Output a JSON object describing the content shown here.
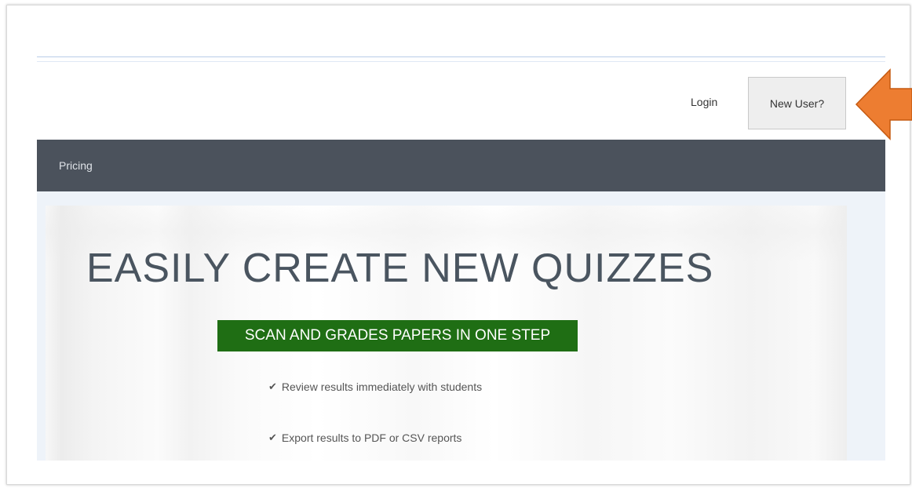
{
  "header": {
    "login_label": "Login",
    "new_user_label": "New User?"
  },
  "navbar": {
    "items": [
      {
        "label": "Pricing"
      }
    ]
  },
  "hero": {
    "title": "EASILY CREATE NEW QUIZZES",
    "badge": "SCAN AND GRADES PAPERS IN ONE STEP",
    "features": [
      {
        "icon": "check-icon",
        "text": "Review results immediately with students"
      },
      {
        "icon": "check-icon",
        "text": "Export results to PDF or CSV reports"
      }
    ]
  },
  "colors": {
    "navbar_bg": "#4b525c",
    "badge_bg": "#1f6e14",
    "arrow": "#ed7d31"
  }
}
